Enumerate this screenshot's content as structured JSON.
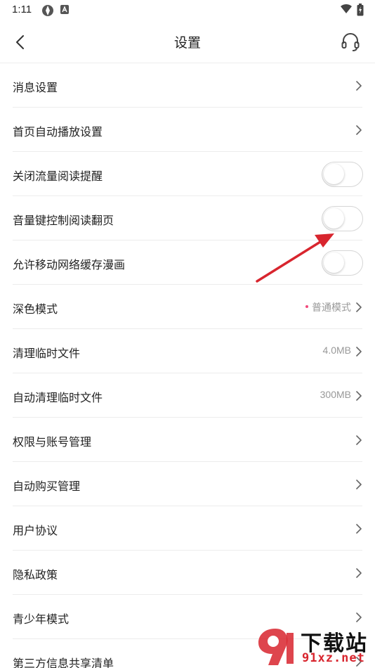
{
  "status_bar": {
    "time": "1:11"
  },
  "header": {
    "title": "设置"
  },
  "settings": [
    {
      "label": "消息设置",
      "type": "link"
    },
    {
      "label": "首页自动播放设置",
      "type": "link"
    },
    {
      "label": "关闭流量阅读提醒",
      "type": "toggle",
      "on": false
    },
    {
      "label": "音量键控制阅读翻页",
      "type": "toggle",
      "on": false
    },
    {
      "label": "允许移动网络缓存漫画",
      "type": "toggle",
      "on": false
    },
    {
      "label": "深色模式",
      "type": "link",
      "value": "普通模式",
      "dot": true
    },
    {
      "label": "清理临时文件",
      "type": "link",
      "value": "4.0MB"
    },
    {
      "label": "自动清理临时文件",
      "type": "link",
      "value": "300MB"
    },
    {
      "label": "权限与账号管理",
      "type": "link"
    },
    {
      "label": "自动购买管理",
      "type": "link"
    },
    {
      "label": "用户协议",
      "type": "link"
    },
    {
      "label": "隐私政策",
      "type": "link"
    },
    {
      "label": "青少年模式",
      "type": "link"
    },
    {
      "label": "第三方信息共享清单",
      "type": "link"
    }
  ],
  "watermark": {
    "title": "下载站",
    "domain": "91xz.net"
  },
  "colors": {
    "accent_dot": "#f24a7c",
    "arrow": "#d8252e",
    "divider": "#ececec"
  },
  "icons": {
    "back": "chevron-left-icon",
    "support": "headset-icon",
    "row_arrow": "chevron-right-icon"
  }
}
